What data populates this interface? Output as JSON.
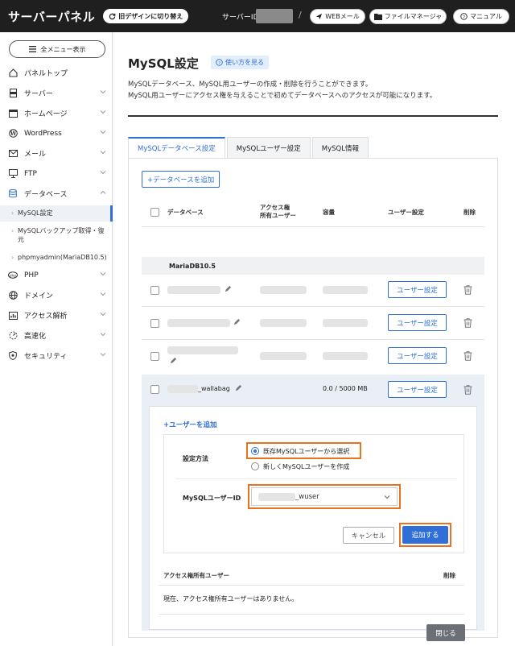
{
  "topbar": {
    "brand": "サーバーパネル",
    "old_design": "旧デザインに切り替え",
    "server_id_label": "サーバーID",
    "slash": "/",
    "webmail": "WEBメール",
    "filemanager": "ファイルマネージャ",
    "manual": "マニュアル"
  },
  "sidebar": {
    "all_menu": "全メニュー表示",
    "items": [
      {
        "label": "パネルトップ",
        "icon": "home-icon"
      },
      {
        "label": "サーバー",
        "icon": "server-icon"
      },
      {
        "label": "ホームページ",
        "icon": "browser-icon"
      },
      {
        "label": "WordPress",
        "icon": "wordpress-icon"
      },
      {
        "label": "メール",
        "icon": "mail-icon"
      },
      {
        "label": "FTP",
        "icon": "monitor-icon"
      },
      {
        "label": "データベース",
        "icon": "database-icon"
      },
      {
        "label": "PHP",
        "icon": "php-icon"
      },
      {
        "label": "ドメイン",
        "icon": "globe-icon"
      },
      {
        "label": "アクセス解析",
        "icon": "chart-icon"
      },
      {
        "label": "高速化",
        "icon": "speed-icon"
      },
      {
        "label": "セキュリティ",
        "icon": "shield-icon"
      }
    ],
    "sub_items": [
      "MySQL設定",
      "MySQLバックアップ取得・復元",
      "phpmyadmin(MariaDB10.5)"
    ]
  },
  "main": {
    "title": "MySQL設定",
    "howto": "使い方を見る",
    "desc1": "MySQLデータベース、MySQL用ユーザーの作成・削除を行うことができます。",
    "desc2": "MySQL用ユーザーにアクセス権を与えることで初めてデータベースへのアクセスが可能になります。",
    "tabs": [
      "MySQLデータベース設定",
      "MySQLユーザー設定",
      "MySQL情報"
    ],
    "add_db": "+データベースを追加",
    "table": {
      "col_db": "データベース",
      "col_access1": "アクセス権",
      "col_access2": "所有ユーザー",
      "col_size": "容量",
      "col_user": "ユーザー設定",
      "col_delete": "削除",
      "group": "MariaDB10.5",
      "user_btn": "ユーザー設定",
      "row4_name": "_wallabag",
      "row4_size": "0.0 / 5000 MB"
    },
    "add_user": {
      "link": "ユーザーを追加",
      "method_label": "設定方法",
      "opt_existing": "既存MySQLユーザーから選択",
      "opt_new": "新しくMySQLユーザーを作成",
      "user_id_label": "MySQLユーザーID",
      "user_id_value": "_wuser",
      "cancel": "キャンセル",
      "submit": "追加する"
    },
    "access": {
      "header": "アクセス権所有ユーザー",
      "delete": "削除",
      "none": "現在、アクセス権所有ユーザーはありません。",
      "close": "閉じる"
    }
  }
}
